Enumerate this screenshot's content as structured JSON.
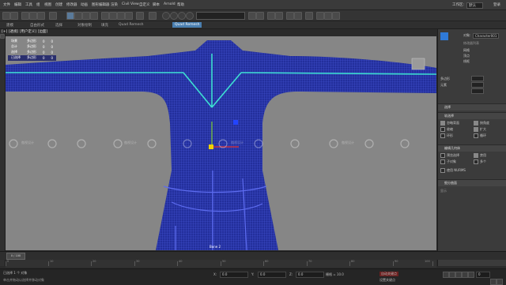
{
  "menubar": {
    "items": [
      "文件",
      "编辑",
      "工具",
      "组",
      "视图",
      "创建",
      "修改器",
      "动画",
      "图形编辑器",
      "渲染",
      "Civil View",
      "自定义",
      "脚本",
      "Arnold",
      "帮助"
    ],
    "workspace_label": "工作区:",
    "workspace_value": "默认",
    "signin": "登录"
  },
  "toolbar": {
    "search_placeholder": ""
  },
  "ribbon": {
    "tabs": [
      "建模",
      "自由形式",
      "选择",
      "对象绘制",
      "填充",
      "Quad Remesh",
      "Quad Remesh"
    ],
    "active_index": 5
  },
  "viewport": {
    "label": "[+] [透视] [用户定义] [边面]",
    "gizmo_label": "Bone 2",
    "table": [
      [
        "场景",
        "多边形",
        "0",
        "0"
      ],
      [
        "总计",
        "多边形",
        "0",
        "0"
      ],
      [
        "选择",
        "多边形",
        "0",
        "0"
      ],
      [
        "已选择",
        "多边形",
        "0",
        "0"
      ]
    ],
    "watermark": "傲视设计"
  },
  "rightpanel": {
    "object_label": "对象:",
    "object_name": "Character001",
    "rows": [
      "修改器列表",
      "网格",
      "顶点",
      "线框",
      "多边形",
      "元素"
    ],
    "section1": "选择",
    "section2": "软选择",
    "section3": "编辑几何体",
    "section4": "细分曲面",
    "checks": [
      "忽略背面",
      "按角度",
      "收缩",
      "扩大",
      "环形",
      "循环",
      "预览选择",
      "禁用",
      "子对象",
      "多个",
      "使用 NURMS"
    ],
    "bottom_label": "显示"
  },
  "timeline": {
    "ticks": [
      "0",
      "10",
      "20",
      "30",
      "40",
      "50",
      "60",
      "70",
      "80",
      "90",
      "100"
    ],
    "frame": "0 / 100"
  },
  "statusbar": {
    "message": "已选择 1 个 对象",
    "prompt": "单击并拖动以选择并移动对象",
    "x_label": "X:",
    "x_value": "0.0",
    "y_label": "Y:",
    "y_value": "0.0",
    "z_label": "Z:",
    "z_value": "0.0",
    "grid": "栅格 = 10.0",
    "autokey": "自动关键点",
    "setkey": "设置关键点",
    "frame_value": "0"
  }
}
